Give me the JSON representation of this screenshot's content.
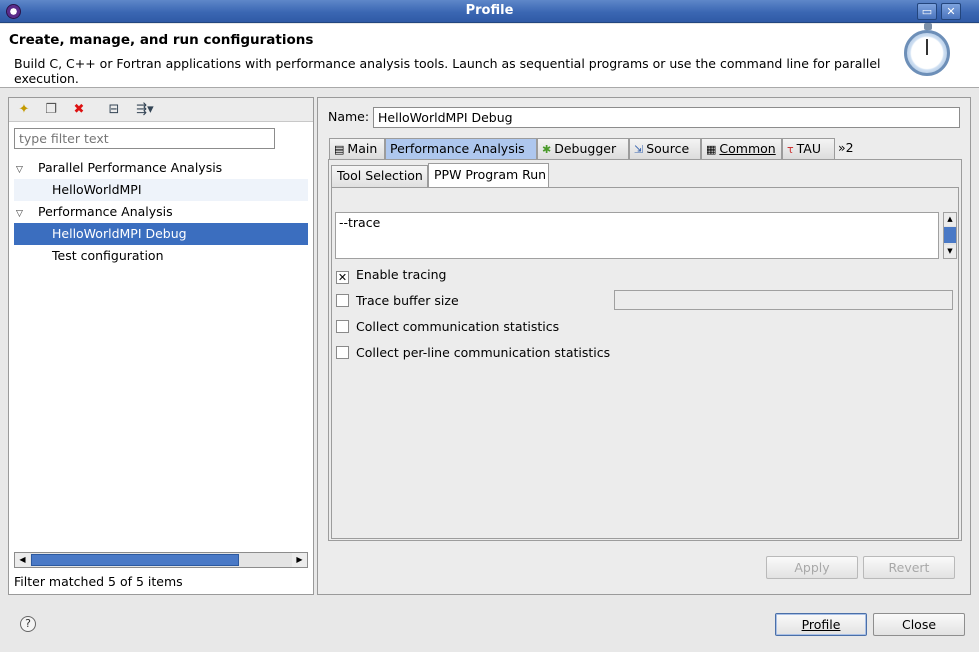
{
  "window": {
    "title": "Profile"
  },
  "header": {
    "title": "Create, manage, and run configurations",
    "description": "Build C, C++ or Fortran applications with performance analysis tools.  Launch as sequential programs or use the command line for parallel execution."
  },
  "left_panel": {
    "toolbar_icons": [
      "new-config-icon",
      "duplicate-icon",
      "delete-icon",
      "collapse-all-icon",
      "filter-icon"
    ],
    "filter_placeholder": "type filter text",
    "tree": [
      {
        "label": "Parallel Performance Analysis",
        "level": 0,
        "expanded": true
      },
      {
        "label": "HelloWorldMPI",
        "level": 1
      },
      {
        "label": "Performance Analysis",
        "level": 0,
        "expanded": true
      },
      {
        "label": "HelloWorldMPI Debug",
        "level": 1,
        "selected": true
      },
      {
        "label": "Test configuration",
        "level": 1
      }
    ],
    "status": "Filter matched 5 of 5 items"
  },
  "right_panel": {
    "name_label": "Name:",
    "name_value": "HelloWorldMPI Debug",
    "tabs": [
      {
        "label": "Main",
        "icon": "page-icon"
      },
      {
        "label": "Performance Analysis",
        "active": true
      },
      {
        "label": "Debugger",
        "icon": "bug-icon"
      },
      {
        "label": "Source",
        "icon": "source-icon"
      },
      {
        "label": "Common",
        "icon": "common-icon"
      },
      {
        "label": "TAU",
        "icon": "tau-icon"
      }
    ],
    "overflow_label": "»2",
    "subtabs": [
      {
        "label": "Tool Selection"
      },
      {
        "label": "PPW Program Run",
        "active": true
      }
    ],
    "args_text": "--trace",
    "options": [
      {
        "label": "Enable tracing",
        "checked": true
      },
      {
        "label": "Trace buffer size",
        "checked": false
      },
      {
        "label": "Collect communication statistics",
        "checked": false
      },
      {
        "label": "Collect per-line communication statistics",
        "checked": false
      }
    ],
    "apply_label": "Apply",
    "revert_label": "Revert"
  },
  "footer": {
    "profile_label": "Profile",
    "close_label": "Close"
  },
  "colors": {
    "selection": "#3b6ebf",
    "titlebar": "#3b67b3",
    "active_tab": "#aec7ee"
  }
}
